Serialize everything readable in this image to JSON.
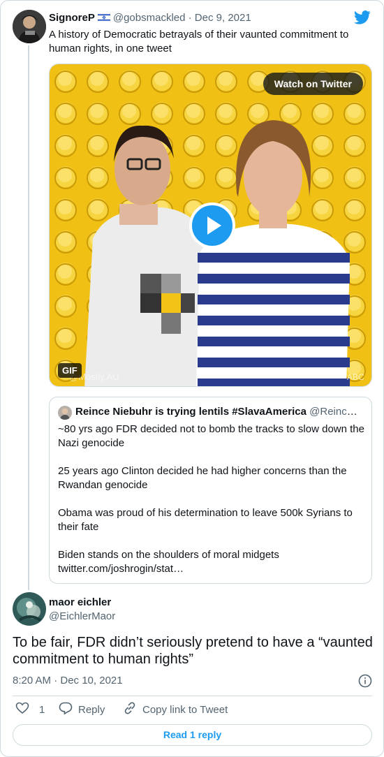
{
  "tweet": {
    "author_name": "SignoreP",
    "author_handle": "@gobsmackled",
    "date": "· Dec 9, 2021",
    "text": "A history of Democratic betrayals of their vaunted commitment to human rights, in one tweet",
    "media": {
      "watch_label": "Watch on Twitter",
      "gif_label": "GIF"
    }
  },
  "quote": {
    "author_name": "Reince Niebuhr is trying lentils #SlavaAmerica",
    "author_handle": "@Reince…",
    "paragraphs": [
      "~80 yrs ago FDR decided not to bomb the tracks to slow down the Nazi genocide",
      "25 years ago Clinton decided he had higher concerns than the Rwandan genocide",
      "Obama was proud of his determination to leave 500k Syrians to their fate",
      "Biden stands on the shoulders of moral midgets",
      "twitter.com/joshrogin/stat…"
    ]
  },
  "reply": {
    "author_name": "maor eichler",
    "author_handle": "@EichlerMaor",
    "text": "To be fair, FDR didn’t seriously pretend to have a “vaunted commitment to human rights”",
    "timestamp": "8:20 AM · Dec 10, 2021",
    "like_count": "1",
    "reply_label": "Reply",
    "copy_label": "Copy link to Tweet",
    "read_replies_label": "Read 1 reply"
  },
  "colors": {
    "accent": "#1d9bf0",
    "muted": "#536471",
    "border": "#cfd9de",
    "lego_yellow": "#f2c418"
  },
  "icons": [
    "twitter-bird-icon",
    "israel-flag-icon",
    "play-icon",
    "info-icon",
    "heart-icon",
    "reply-bubble-icon",
    "link-icon"
  ]
}
